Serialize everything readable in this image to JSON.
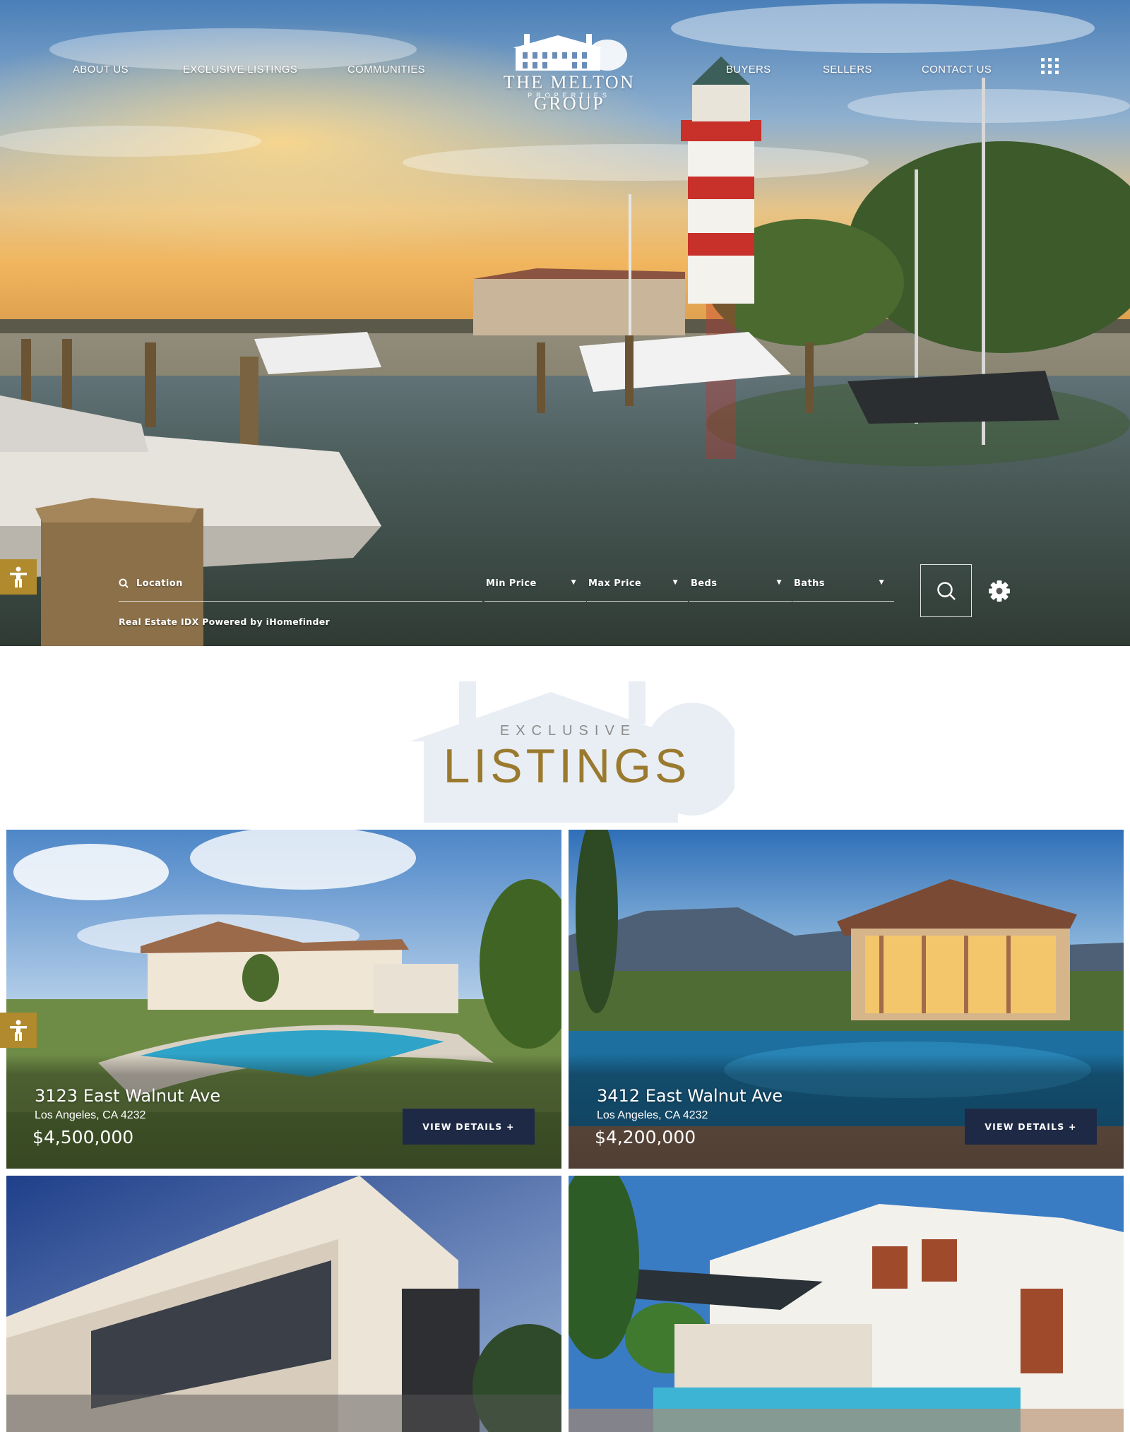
{
  "nav": {
    "left": [
      "ABOUT US",
      "EXCLUSIVE LISTINGS",
      "COMMUNITIES"
    ],
    "right": [
      "BUYERS",
      "SELLERS",
      "CONTACT US"
    ],
    "menu_icon": "grid-menu-icon"
  },
  "logo": {
    "title": "THE MELTON GROUP",
    "subtitle": "PROPERTIES",
    "icon": "house-logo-icon"
  },
  "search": {
    "location_label": "Location",
    "min_price_label": "Min Price",
    "max_price_label": "Max Price",
    "beds_label": "Beds",
    "baths_label": "Baths",
    "powered_by": "Real Estate IDX Powered by iHomefinder",
    "search_icon": "search-icon",
    "settings_icon": "gear-icon"
  },
  "accessibility": {
    "icon": "accessibility-icon",
    "color": "#b08a2c"
  },
  "listings_section": {
    "kicker": "EXCLUSIVE",
    "title": "LISTINGS",
    "title_color": "#9a7a2e"
  },
  "listings": [
    {
      "address": "3123 East Walnut Ave",
      "city": "Los Angeles, CA 4232",
      "price": "$4,500,000",
      "button": "VIEW DETAILS +"
    },
    {
      "address": "3412 East Walnut Ave",
      "city": "Los Angeles, CA 4232",
      "price": "$4,200,000",
      "button": "VIEW DETAILS +"
    }
  ],
  "colors": {
    "button_bg": "#1e2a45",
    "accent_gold": "#b08a2c"
  }
}
